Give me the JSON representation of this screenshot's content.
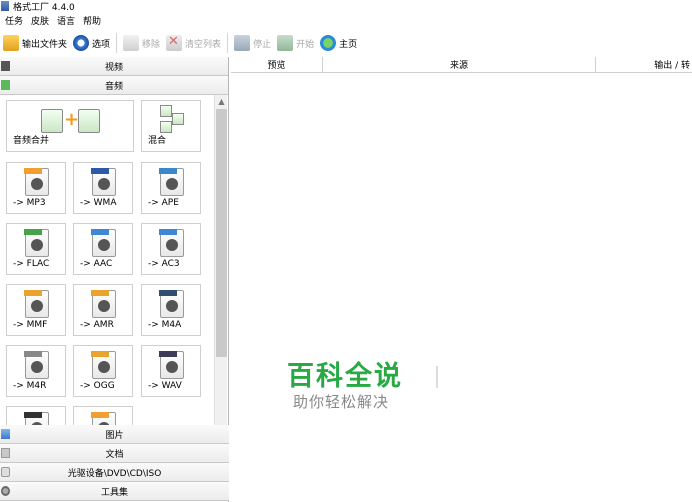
{
  "window": {
    "title": "格式工厂 4.4.0"
  },
  "menu": [
    "任务",
    "皮肤",
    "语言",
    "帮助"
  ],
  "toolbar": {
    "output_folder": "输出文件夹",
    "options": "选项",
    "remove": "移除",
    "clear_list": "清空列表",
    "stop": "停止",
    "start": "开始",
    "home": "主页"
  },
  "categories": {
    "video": "视频",
    "audio": "音频",
    "image": "图片",
    "document": "文档",
    "rom": "光驱设备\\DVD\\CD\\ISO",
    "tools": "工具集"
  },
  "audio_tools": {
    "merge": "音频合并",
    "mix": "混合",
    "tiles": [
      {
        "label": "-> MP3",
        "tag": "MP3",
        "color": "#f0a030"
      },
      {
        "label": "-> WMA",
        "tag": "WMA",
        "color": "#2a5aa8"
      },
      {
        "label": "-> APE",
        "tag": "APE",
        "color": "#3a88c8"
      },
      {
        "label": "-> FLAC",
        "tag": "FLAC",
        "color": "#47a34a"
      },
      {
        "label": "-> AAC",
        "tag": "AAC",
        "color": "#3f86d4"
      },
      {
        "label": "-> AC3",
        "tag": "AAC",
        "color": "#3f86d4"
      },
      {
        "label": "-> MMF",
        "tag": "MMF",
        "color": "#e8a42c"
      },
      {
        "label": "-> AMR",
        "tag": "AMR",
        "color": "#e8a42c"
      },
      {
        "label": "-> M4A",
        "tag": "M4A",
        "color": "#2f4f6f"
      },
      {
        "label": "-> M4R",
        "tag": "M4R",
        "color": "#888888"
      },
      {
        "label": "-> OGG",
        "tag": "OGG",
        "color": "#e8a42c"
      },
      {
        "label": "-> WAV",
        "tag": "WAV",
        "color": "#3b3b5a"
      },
      {
        "label": "",
        "tag": "WV",
        "color": "#333333"
      },
      {
        "label": "",
        "tag": "MP2",
        "color": "#f0a030"
      }
    ]
  },
  "list_columns": [
    "预览",
    "来源",
    "输出 / 转"
  ],
  "watermark": {
    "title": "百科全说",
    "subtitle": "助你轻松解决"
  }
}
